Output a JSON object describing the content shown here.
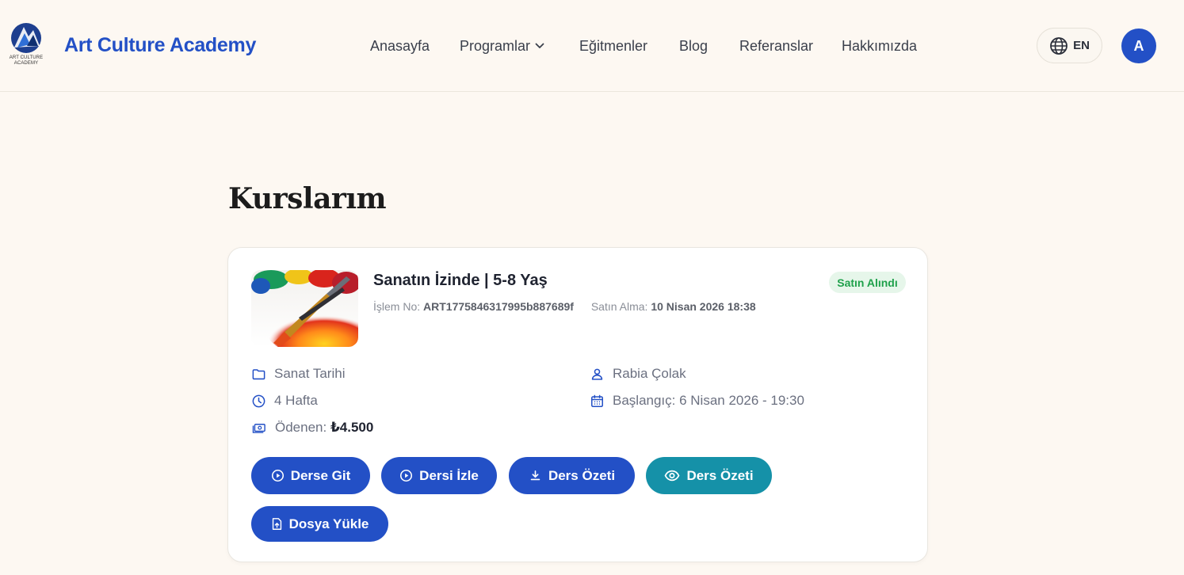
{
  "header": {
    "logo_caption": "ART CULTURE ACADEMY",
    "brand": "Art Culture Academy",
    "nav": [
      {
        "label": "Anasayfa"
      },
      {
        "label": "Programlar",
        "dropdown": true
      },
      {
        "label": "Eğitmenler"
      },
      {
        "label": "Blog"
      },
      {
        "label": "Referanslar"
      },
      {
        "label": "Hakkımızda"
      }
    ],
    "language": "EN",
    "avatar_initial": "A"
  },
  "page": {
    "title": "Kurslarım"
  },
  "course": {
    "title": "Sanatın İzinde | 5-8 Yaş",
    "transaction_label": "İşlem No:",
    "transaction_value": "ART1775846317995b887689f",
    "purchase_label": "Satın Alma:",
    "purchase_value": "10 Nisan 2026 18:38",
    "status": "Satın Alındı",
    "category": "Sanat Tarihi",
    "duration": "4 Hafta",
    "paid_label": "Ödenen:",
    "paid_value": "₺4.500",
    "instructor": "Rabia Çolak",
    "start": "Başlangıç: 6 Nisan 2026 - 19:30"
  },
  "actions": {
    "go_to_lesson": "Derse Git",
    "watch_lesson": "Dersi İzle",
    "download_summary": "Ders Özeti",
    "view_summary": "Ders Özeti",
    "upload_file": "Dosya Yükle"
  },
  "colors": {
    "primary": "#2350c6",
    "teal": "#1591a8",
    "status_green": "#1fa14b",
    "background": "#fdf8f2"
  }
}
